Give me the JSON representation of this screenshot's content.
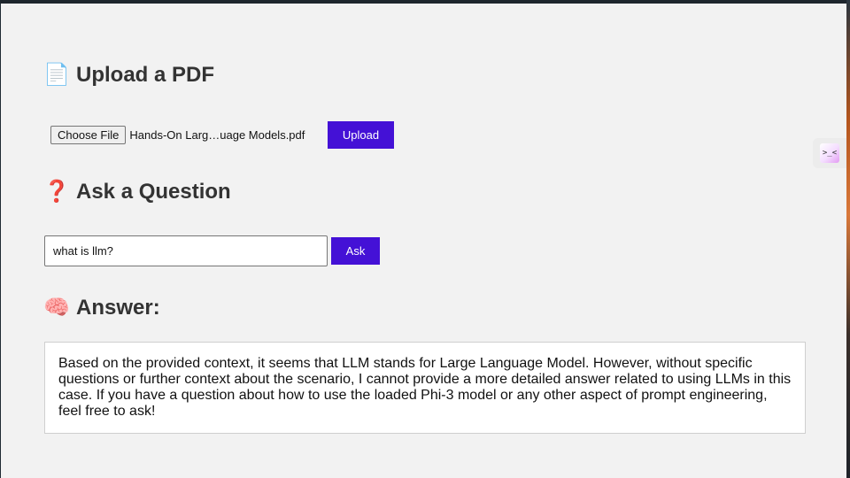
{
  "upload_section": {
    "heading_emoji": "📄",
    "heading": "Upload a PDF",
    "choose_file_label": "Choose File",
    "file_name": "Hands-On Larg…uage Models.pdf",
    "upload_button": "Upload"
  },
  "ask_section": {
    "heading_emoji": "❓",
    "heading": "Ask a Question",
    "question_value": "what is llm?",
    "ask_button": "Ask"
  },
  "answer_section": {
    "heading_emoji": "🧠",
    "heading": "Answer:",
    "text": "Based on the provided context, it seems that LLM stands for Large Language Model. However, without specific questions or further context about the scenario, I cannot provide a more detailed answer related to using LLMs in this case. If you have a question about how to use the loaded Phi-3 model or any other aspect of prompt engineering, feel free to ask!"
  },
  "side_widget": {
    "glyph": ">_<"
  },
  "colors": {
    "accent": "#4411d6",
    "page_background": "#f2f2f2",
    "heading_text": "#333333"
  }
}
